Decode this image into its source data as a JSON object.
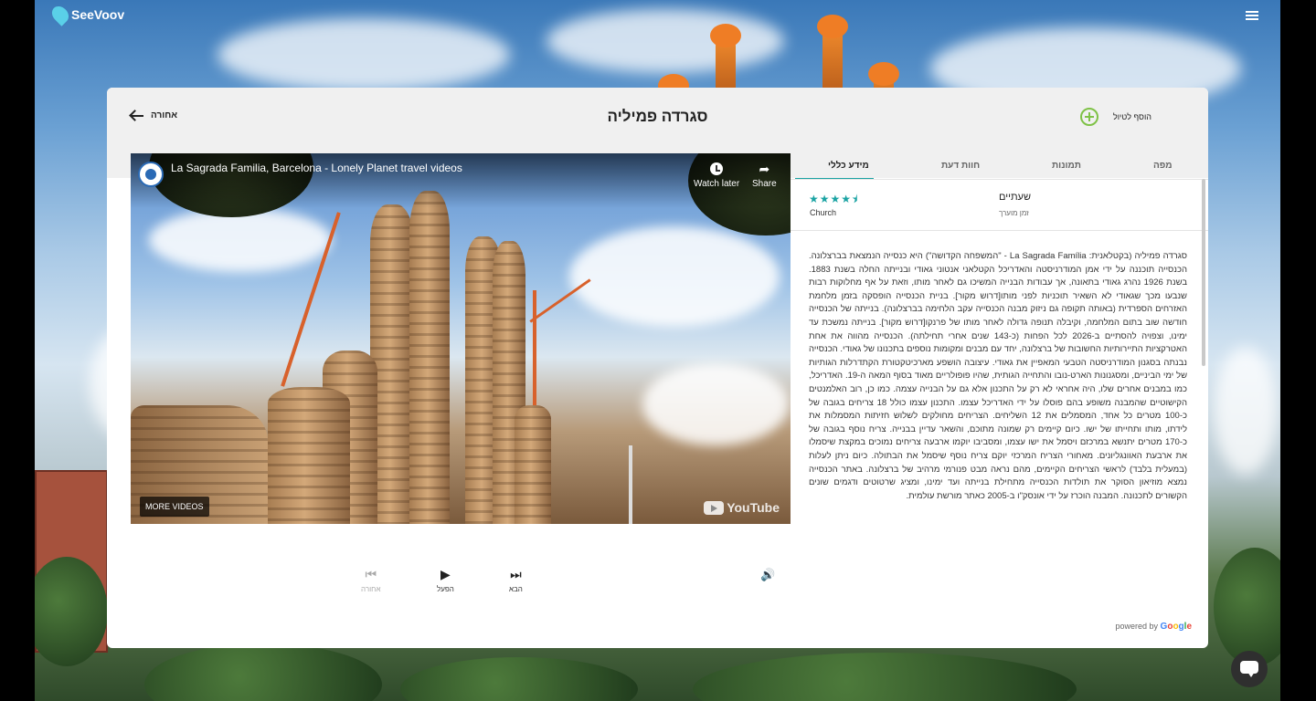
{
  "app": {
    "name": "SeeVoov"
  },
  "header": {
    "back_label": "אחורה",
    "title": "סגרדה פמיליה",
    "add_trip_label": "הוסף לטיול"
  },
  "video": {
    "title": "La Sagrada Familia, Barcelona - Lonely Planet travel videos",
    "watch_later": "Watch later",
    "share": "Share",
    "more_videos": "MORE VIDEOS",
    "youtube": "YouTube"
  },
  "controls": {
    "previous": "אחורה",
    "play": "הפעל",
    "next": "הבא"
  },
  "tabs": [
    {
      "label": "מידע כללי",
      "active": true
    },
    {
      "label": "חוות דעת",
      "active": false
    },
    {
      "label": "תמונות",
      "active": false
    },
    {
      "label": "מפה",
      "active": false
    }
  ],
  "details": {
    "rating": 4.5,
    "rating_stars": "★★★★⯨",
    "category": "Church",
    "duration": "שעתיים",
    "duration_label": "זמן מוערך"
  },
  "description": "סגרדה פמיליה (בקטלאנית: La Sagrada Família - \"המשפחה הקדושה\") היא כנסייה הנמצאת בברצלונה. הכנסייה תוכננה על ידי אמן המודרניסטה והאדריכל הקטלאני אנטוני גאודי ובנייתה החלה בשנת 1883. בשנת 1926 נהרג גאודי בתאונה, אך עבודות הבנייה המשיכו גם לאחר מותו, וזאת על אף מחלוקות רבות שנבעו מכך שגאודי לא השאיר תוכניות לפני מותו[דרוש מקור]. בניית הכנסייה הופסקה בזמן מלחמת האזרחים הספרדית (באותה תקופה גם ניזוק מבנה הכנסייה עקב הלחימה בברצלונה). בנייתה של הכנסייה חודשה שוב בתום המלחמה, וקיבלה תנופה גדולה לאחר מותו של פרנקו[דרוש מקור]. בנייתה נמשכת עד ימינו, וצפויה להסתיים ב-2026 לכל הפחות (כ-143 שנים אחרי תחילתה). הכנסייה מהווה את אחת האטרקציות התיירותיות החשובות של ברצלונה, יחד עם מבנים ומקומות נוספים בתכנונו של גאודי. הכנסייה נבנתה בסגנון המודרניסטה הטבעי המאפיין את גאודי. עיצובה הושפע מארכיטקטורת הקתדרלות הגותיות של ימי הביניים, ומסגנונות הארט-נובו והתחייה הגותית, שהיו פופולריים מאוד בסוף המאה ה-19. האדריכל, כמו במבנים אחרים שלו, היה אחראי לא רק על התכנון אלא גם על הבנייה עצמה. כמו כן, רוב האלמנטים הקישוטיים שהמבנה משופע בהם פוסלו על ידי האדריכל עצמו. התכנון עצמו כולל 18 צריחים בגובה של כ-100 מטרים כל אחד, המסמלים את 12 השליחים. הצריחים מחולקים לשלוש חזיתות המסמלות את לידתו, מותו ותחייתו של ישו. כיום קיימים רק שמונה מתוכם, והשאר עדיין בבנייה. צריח נוסף בגובה של כ-170 מטרים יתנשא במרכזם ויסמל את ישו עצמו, ומסביבו יוקמו ארבעה צריחים נמוכים במקצת שיסמלו את ארבעת האוונגליונים. מאחורי הצריח המרכזי יוקם צריח נוסף שיסמל את הבתולה. כיום ניתן לעלות (במעלית בלבד) לראשי הצריחים הקיימים, מהם נראה מבט פנורמי מרהיב של ברצלונה. באתר הכנסייה נמצא מוזיאון הסוקר את תולדות הכנסייה מתחילת בנייתה ועד ימינו, ומציג שרטוטים ודגמים שונים הקשורים לתכנונה. המבנה הוכרז על ידי אונסק\"ו ב-2005 כאתר מורשת עולמית.",
  "footer": {
    "powered_by": "powered by",
    "google": [
      "G",
      "o",
      "o",
      "g",
      "l",
      "e"
    ]
  },
  "colors": {
    "accent": "#1aa3a3",
    "add_green": "#7fc247"
  },
  "icons": [
    "logo-pin-icon",
    "menu-icon",
    "arrow-left-icon",
    "plus-circle-icon",
    "clock-icon",
    "share-icon",
    "skip-previous-icon",
    "play-icon",
    "skip-next-icon",
    "volume-icon",
    "chat-icon"
  ]
}
